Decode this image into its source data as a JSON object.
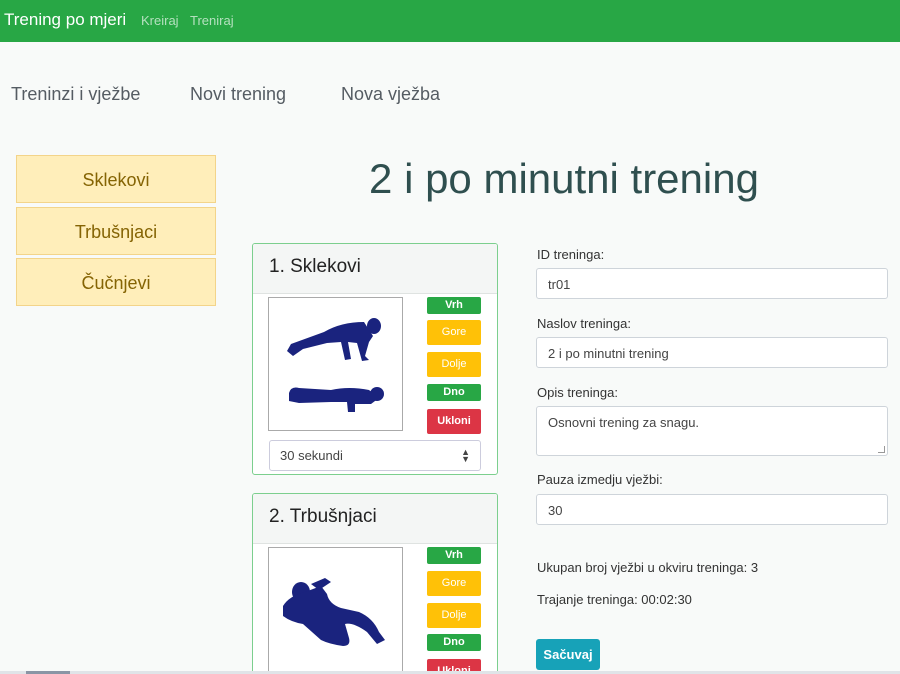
{
  "navbar": {
    "brand": "Trening po mjeri",
    "links": [
      "Kreiraj",
      "Treniraj"
    ]
  },
  "tabs": [
    "Treninzi i vježbe",
    "Novi trening",
    "Nova vježba"
  ],
  "sidebar": {
    "items": [
      {
        "label": "Sklekovi"
      },
      {
        "label": "Trbušnjaci"
      },
      {
        "label": "Čučnjevi"
      }
    ]
  },
  "page_title": "2 i po minutni trening",
  "exercises": [
    {
      "title": "1. Sklekovi",
      "icon": "pushup-figure-icon",
      "buttons": {
        "top": "Vrh",
        "up": "Gore",
        "down": "Dolje",
        "bottom": "Dno",
        "remove": "Ukloni"
      },
      "duration": "30 sekundi"
    },
    {
      "title": "2. Trbušnjaci",
      "icon": "situp-figure-icon",
      "buttons": {
        "top": "Vrh",
        "up": "Gore",
        "down": "Dolje",
        "bottom": "Dno",
        "remove": "Ukloni"
      }
    }
  ],
  "form": {
    "id_label": "ID treninga:",
    "id_value": "tr01",
    "title_label": "Naslov treninga:",
    "title_value": "2 i po minutni trening",
    "desc_label": "Opis treninga:",
    "desc_value": "Osnovni trening za snagu.",
    "pause_label": "Pauza izmedju vježbi:",
    "pause_value": "30"
  },
  "summary": {
    "count_text": "Ukupan broj vježbi u okviru treninga: 3",
    "duration_text": "Trajanje treninga: 00:02:30"
  },
  "save_label": "Sačuvaj",
  "colors": {
    "navbar": "#28a745",
    "side_item": "#ffeeba",
    "save": "#17a2b8",
    "figure": "#1a237e"
  }
}
